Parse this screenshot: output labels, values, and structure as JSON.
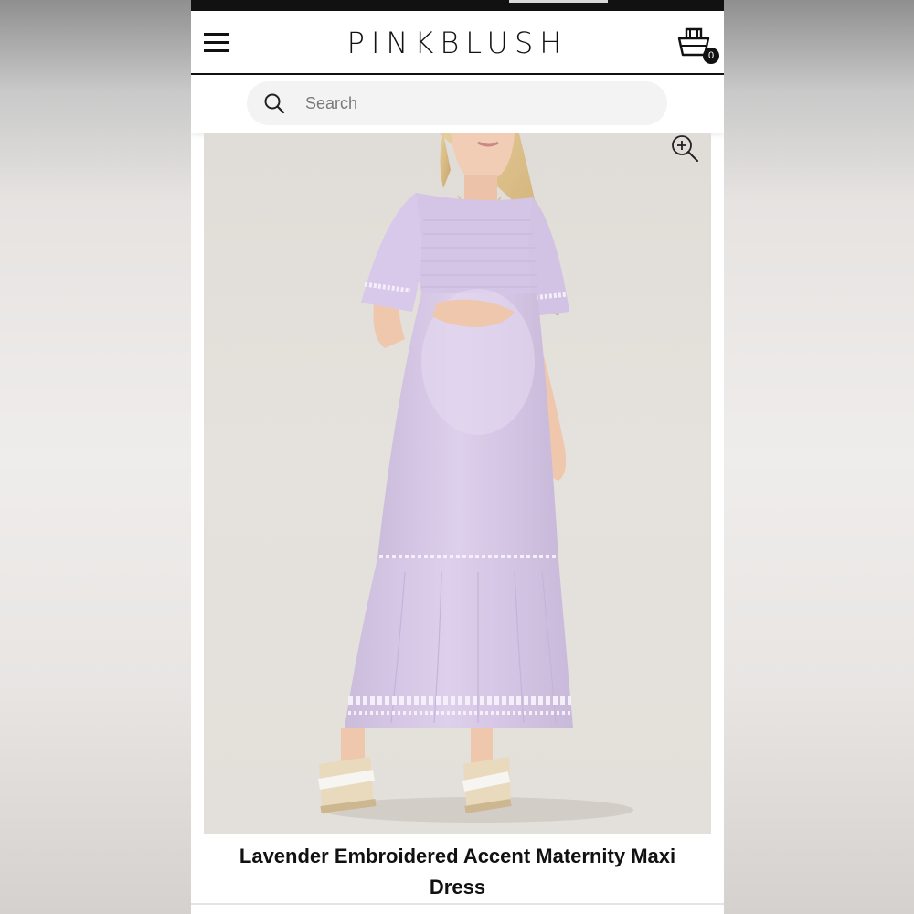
{
  "header": {
    "logo": "PINKBLUSH",
    "menu_icon": "hamburger-menu-icon",
    "cart_icon": "shopping-basket-icon",
    "cart_count": "0"
  },
  "search": {
    "placeholder": "Search",
    "icon": "search-icon"
  },
  "product": {
    "title": "Lavender Embroidered Accent Maternity Maxi Dress",
    "image_alt": "Model wearing lavender maternity maxi dress",
    "zoom_icon": "zoom-in-icon",
    "dress_color": "#d9cbe9"
  },
  "colors": {
    "brand_text": "#111111",
    "dress": "#d9cbe9",
    "backdrop": "#e2ded9"
  }
}
